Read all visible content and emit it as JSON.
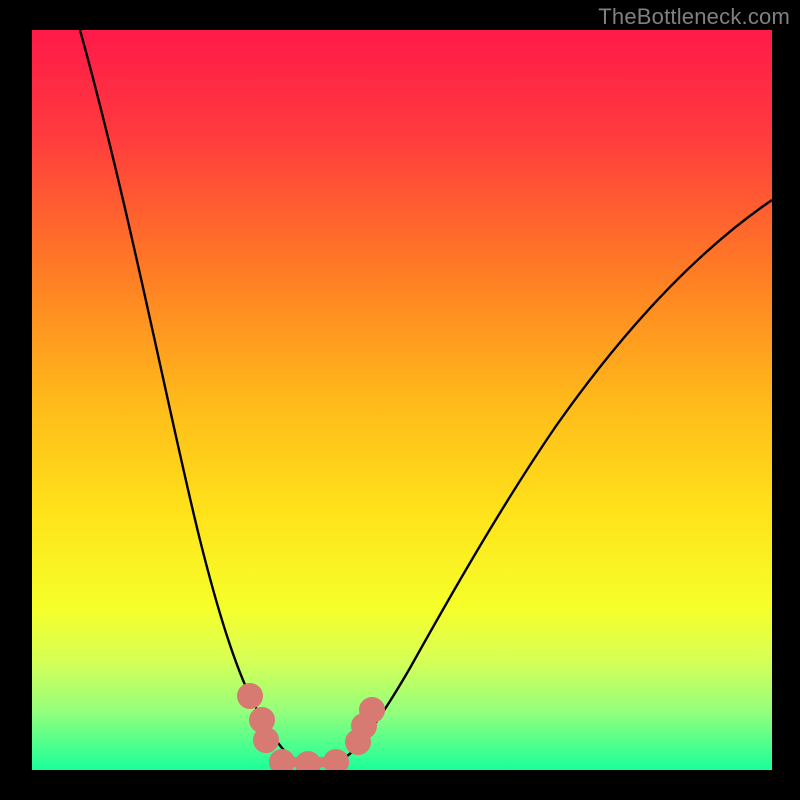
{
  "watermark": "TheBottleneck.com",
  "chart_data": {
    "type": "line",
    "title": "",
    "xlabel": "",
    "ylabel": "",
    "xlim": [
      0,
      100
    ],
    "ylim": [
      0,
      100
    ],
    "background_gradient": {
      "top_color": "#ff1a49",
      "bottom_color": "#1aff9a",
      "meaning_top": "high bottleneck",
      "meaning_bottom": "no bottleneck"
    },
    "series": [
      {
        "name": "bottleneck-curve",
        "color": "#000000",
        "x": [
          6,
          10,
          15,
          20,
          23,
          27,
          30,
          33,
          36,
          38,
          41,
          44,
          48,
          55,
          64,
          73,
          83,
          94,
          100
        ],
        "y": [
          100,
          84,
          66,
          48,
          36,
          24,
          14,
          7,
          2,
          0,
          2,
          8,
          16,
          28,
          42,
          54,
          64,
          72,
          76
        ]
      },
      {
        "name": "optimal-markers",
        "color": "#d77a72",
        "type": "scatter",
        "x": [
          29,
          31,
          32,
          34,
          37,
          41,
          44,
          45,
          46
        ],
        "y": [
          9,
          6,
          4,
          1,
          0,
          1,
          4,
          6,
          8
        ]
      }
    ],
    "grid": false,
    "legend": false
  }
}
